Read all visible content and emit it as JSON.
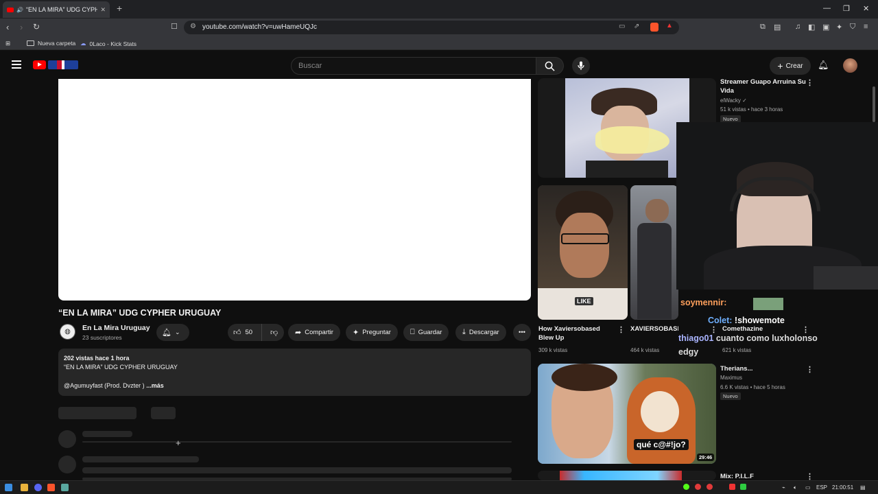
{
  "browser": {
    "tab_title": "“EN LA MIRA” UDG CYPHER U",
    "url": "youtube.com/watch?v=uwHameUQJc",
    "bookmarks": [
      "Nueva carpeta",
      "0Laco - Kick Stats"
    ]
  },
  "header": {
    "search_placeholder": "Buscar",
    "create_label": "Crear"
  },
  "video": {
    "title": "“EN LA MIRA” UDG CYPHER URUGUAY",
    "channel": "En La Mira Uruguay",
    "subscribers": "23 suscriptores",
    "likes": "50",
    "share": "Compartir",
    "ask": "Preguntar",
    "save": "Guardar",
    "download": "Descargar",
    "description": {
      "meta": "202 vistas  hace 1 hora",
      "line1": "“EN LA MIRA” UDG CYPHER URUGUAY",
      "line2": "@Agumuyfast (Prod. Dvzter )",
      "more": "...más"
    }
  },
  "sidebar": {
    "items": [
      {
        "title": "Streamer Guapo Arruina Su Vida",
        "channel": "elWacky",
        "stats": "51 k vistas • hace 3 horas",
        "badge": "Nuevo"
      },
      {
        "title": "How Xaviersobased Blew Up",
        "stats": "309 k vistas"
      },
      {
        "title": "XAVIERSOBASED TOOK MY HAT",
        "stats": "464 k vistas"
      },
      {
        "title": "Comethazine",
        "stats": "621 k vistas"
      },
      {
        "title": "Therians...",
        "channel": "Maximus",
        "stats": "6.6 K vistas • hace 5 horas",
        "badge": "Nuevo",
        "duration": "29:46",
        "thumb_text": "qué c@#!jo?"
      },
      {
        "title": "Mix: P.I.L.F"
      }
    ],
    "thumb_like": "LIKE"
  },
  "overlay": {
    "chat": [
      {
        "user": "soymennir:",
        "msg": ""
      },
      {
        "user": "Colet:",
        "msg": "!showemote"
      },
      {
        "user": "thiago01",
        "msg": "cuanto como luxholonso"
      },
      {
        "user": "",
        "msg": "edgy"
      }
    ]
  },
  "taskbar": {
    "lang": "ESP",
    "time": "21:00:51"
  },
  "colors": {
    "yt_red": "#ff0000",
    "background": "#0f0f0f",
    "chat_user_soymennir": "#ff7f50",
    "chat_user_colet": "#5fa8ff"
  }
}
